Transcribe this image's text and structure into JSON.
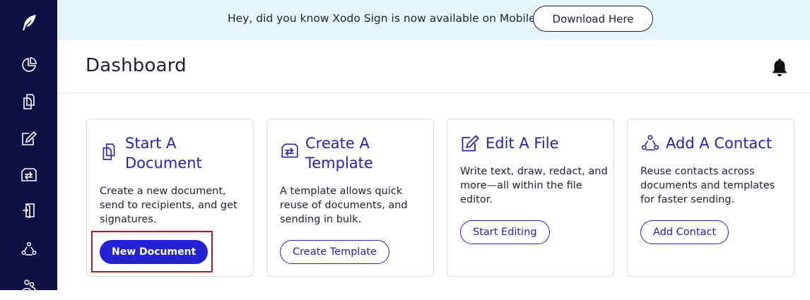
{
  "sidebar": {
    "items": [
      {
        "icon": "feather-logo-icon"
      },
      {
        "icon": "pie-chart-icon"
      },
      {
        "icon": "documents-icon"
      },
      {
        "icon": "edit-icon"
      },
      {
        "icon": "template-icon"
      },
      {
        "icon": "door-icon"
      },
      {
        "icon": "contacts-icon"
      },
      {
        "icon": "team-icon"
      }
    ]
  },
  "banner": {
    "text": "Hey, did you know Xodo Sign is now available on Mobile?",
    "button_label": "Download Here"
  },
  "header": {
    "title": "Dashboard",
    "bell_icon": "bell-icon"
  },
  "cards": [
    {
      "title": "Start A Document",
      "description": "Create a new document, send to recipients, and get signatures.",
      "button_label": "New Document",
      "icon": "documents-icon"
    },
    {
      "title": "Create A Template",
      "description": "A template allows quick reuse of documents, and sending in bulk.",
      "button_label": "Create Template",
      "icon": "template-icon"
    },
    {
      "title": "Edit A File",
      "description": "Write text, draw, redact, and more—all within the file editor.",
      "button_label": "Start Editing",
      "icon": "edit-icon"
    },
    {
      "title": "Add A Contact",
      "description": "Reuse contacts across documents and templates for faster sending.",
      "button_label": "Add Contact",
      "icon": "contacts-icon"
    }
  ],
  "colors": {
    "sidebar": "#0e0f45",
    "banner": "#e5f6f9",
    "accent": "#2322d6",
    "highlight": "#b01c23"
  }
}
